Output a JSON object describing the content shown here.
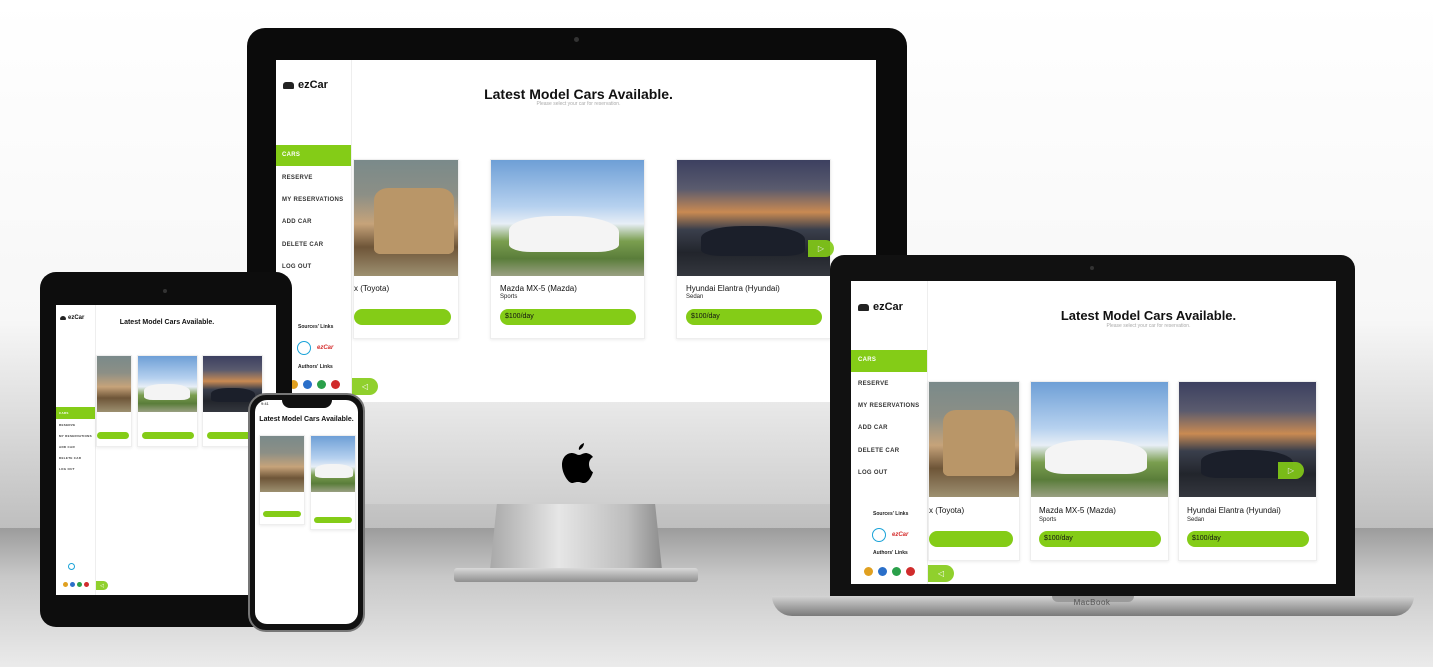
{
  "app": {
    "logo_text": "ezCar"
  },
  "colors": {
    "accent": "#84cc17",
    "text": "#111111"
  },
  "header": {
    "title": "Latest Model Cars Available.",
    "subtitle": "Please select your car for reservation."
  },
  "nav": {
    "items": [
      {
        "label": "CARS",
        "active": true
      },
      {
        "label": "RESERVE",
        "active": false
      },
      {
        "label": "MY RESERVATIONS",
        "active": false
      },
      {
        "label": "ADD CAR",
        "active": false
      },
      {
        "label": "DELETE CAR",
        "active": false
      },
      {
        "label": "LOG OUT",
        "active": false
      }
    ]
  },
  "sidebar_footer": {
    "sources_label": "Sources' Links",
    "authors_label": "Authors' Links"
  },
  "cars": [
    {
      "name_visible": "x (Toyota)",
      "type": "",
      "price": "",
      "image": "toyota-tacoma-photo"
    },
    {
      "name": "Mazda MX-5 (Mazda)",
      "type": "Sports",
      "price": "$100/day",
      "image": "mazda-mx5-photo"
    },
    {
      "name": "Hyundai Elantra (Hyundai)",
      "type": "Sedan",
      "price": "$100/day",
      "image": "hyundai-elantra-photo"
    }
  ],
  "devices": {
    "macbook_label": "MacBook",
    "iphone_time": "9:41"
  },
  "icons": {
    "logo": "car-icon",
    "next": "chevron-right-icon",
    "prev": "chevron-left-icon",
    "react": "react-icon",
    "github": "github-icon",
    "apple": "apple-logo"
  }
}
